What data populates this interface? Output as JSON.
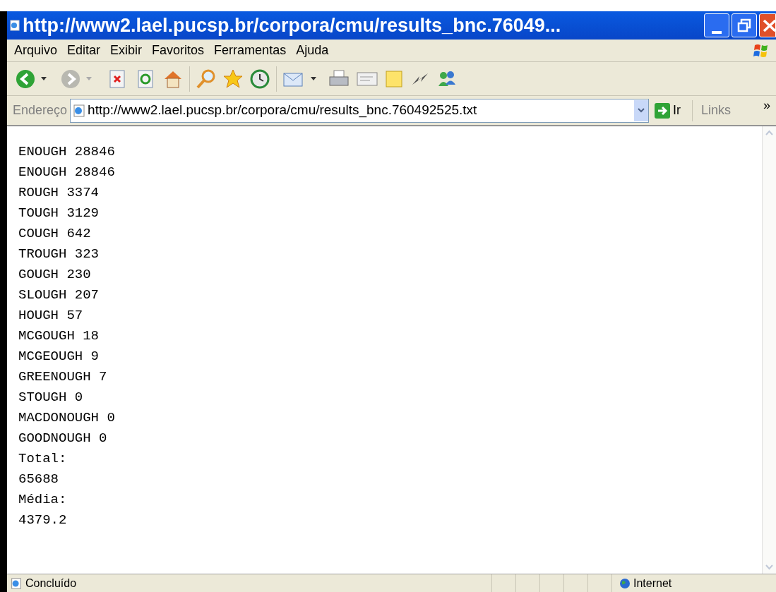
{
  "window": {
    "title": "http://www2.lael.pucsp.br/corpora/cmu/results_bnc.76049..."
  },
  "menu": [
    "Arquivo",
    "Editar",
    "Exibir",
    "Favoritos",
    "Ferramentas",
    "Ajuda"
  ],
  "address_bar": {
    "label": "Endereço",
    "value": "http://www2.lael.pucsp.br/corpora/cmu/results_bnc.760492525.txt",
    "go": "Ir",
    "links": "Links",
    "more": "»"
  },
  "content": {
    "lines": [
      "ENOUGH 28846",
      "ENOUGH 28846",
      "ROUGH 3374",
      "TOUGH 3129",
      "COUGH 642",
      "TROUGH 323",
      "GOUGH 230",
      "SLOUGH 207",
      "HOUGH 57",
      "MCGOUGH 18",
      "MCGEOUGH 9",
      "GREENOUGH 7",
      "STOUGH 0",
      "MACDONOUGH 0",
      "GOODNOUGH 0",
      "Total:",
      "65688",
      "Média:",
      "4379.2"
    ]
  },
  "status_bar": {
    "status": "Concluído",
    "zone": "Internet"
  }
}
